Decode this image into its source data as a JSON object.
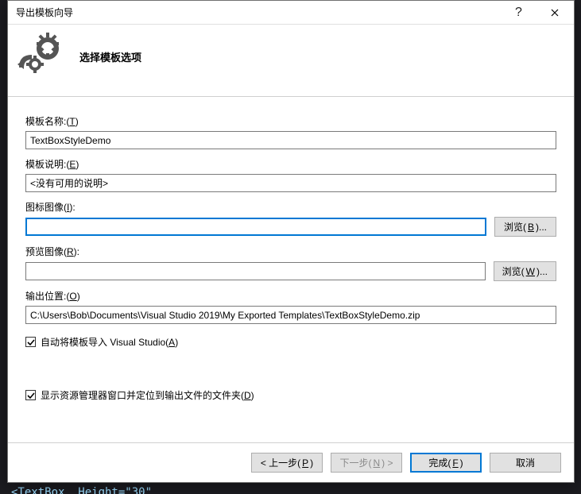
{
  "window": {
    "title": "导出模板向导"
  },
  "header": {
    "pagetitle": "选择模板选项"
  },
  "labels": {
    "template_name": "模板名称:(T)",
    "template_desc": "模板说明:(E)",
    "icon_image": "图标图像(I):",
    "preview_image": "预览图像(R):",
    "output_location": "输出位置:(O)"
  },
  "fields": {
    "template_name": "TextBoxStyleDemo",
    "template_desc": "<没有可用的说明>",
    "icon_image": "",
    "preview_image": "",
    "output_location": "C:\\Users\\Bob\\Documents\\Visual Studio 2019\\My Exported Templates\\TextBoxStyleDemo.zip"
  },
  "buttons": {
    "browse_b": "浏览(B)...",
    "browse_w": "浏览(W)...",
    "back": "< 上一步(P)",
    "next": "下一步(N) >",
    "finish": "完成(F)",
    "cancel": "取消"
  },
  "checks": {
    "auto_import": {
      "checked": true,
      "label": "自动将模板导入 Visual Studio(A)"
    },
    "open_explorer": {
      "checked": true,
      "label": "显示资源管理器窗口并定位到输出文件的文件夹(D)"
    }
  },
  "backdrop_code": "<TextBox  Height=\"30\""
}
